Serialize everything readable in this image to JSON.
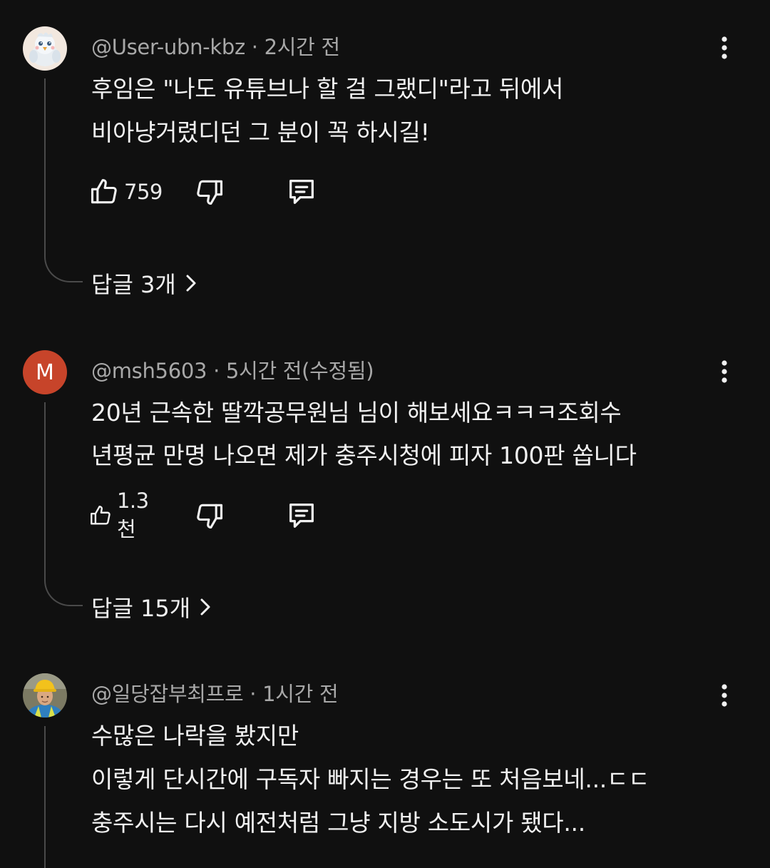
{
  "comments": [
    {
      "author": "@User-ubn-kbz",
      "time": "· 2시간 전",
      "lines": [
        "후임은 \"나도 유튜브나 할 걸 그랬디\"라고 뒤에서",
        "비아냥거렸디던 그 분이 꼭 하시길!"
      ],
      "likes": "759",
      "replies_label": "답글 3개"
    },
    {
      "avatar_letter": "M",
      "author": "@msh5603",
      "time": "· 5시간 전(수정됨)",
      "lines": [
        "20년 근속한 딸깍공무원님 님이 해보세요ㅋㅋㅋ조회수",
        "년평균 만명 나오면 제가 충주시청에 피자 100판 쏩니다"
      ],
      "likes": "1.3천",
      "replies_label": "답글 15개"
    },
    {
      "author": "@일당잡부최프로",
      "time": "· 1시간 전",
      "lines": [
        "수많은 나락을 봤지만",
        "이렇게 단시간에 구독자 빠지는 경우는 또 처음보네...ㄷㄷ",
        "충주시는 다시 예전처럼 그냥 지방 소도시가 됐다..."
      ]
    }
  ],
  "icons": {
    "like": "thumbs-up-icon",
    "dislike": "thumbs-down-icon",
    "reply": "reply-comment-icon",
    "menu": "more-vertical-icon",
    "expand": "chevron-right-icon"
  },
  "colors": {
    "background": "#101010",
    "text": "#f1f1f1",
    "meta": "#a8a8a8",
    "thread_line": "#4a4a4a",
    "avatar_m": "#c7442a"
  }
}
